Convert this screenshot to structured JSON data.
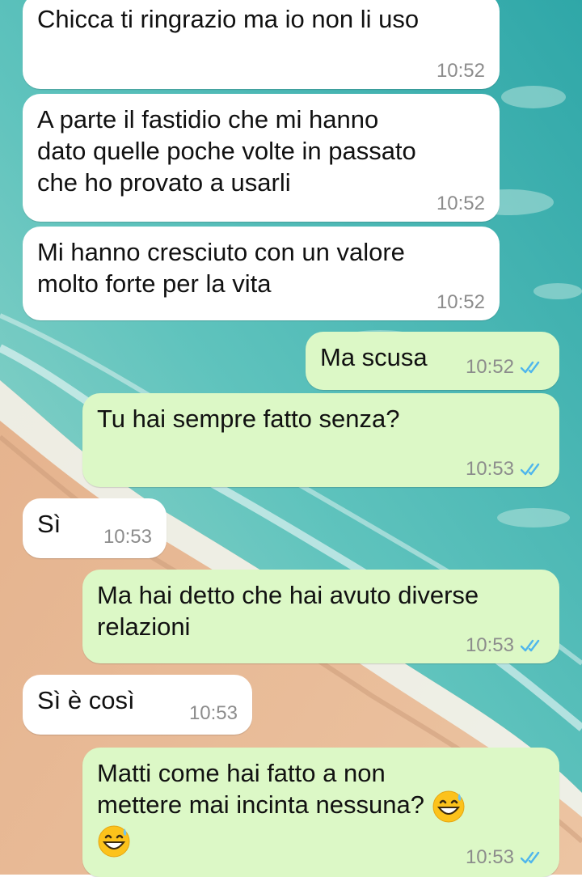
{
  "messages": [
    {
      "direction": "in",
      "text": "Chicca ti ringrazio ma io non li uso",
      "time": "10:52"
    },
    {
      "direction": "in",
      "text": "A parte il fastidio che mi hanno\ndato quelle poche volte in passato\nche ho provato a usarli",
      "time": "10:52"
    },
    {
      "direction": "in",
      "text": "Mi hanno cresciuto con un valore\nmolto forte per la vita",
      "time": "10:52"
    },
    {
      "direction": "out",
      "text": "Ma scusa",
      "time": "10:52",
      "status": "read"
    },
    {
      "direction": "out",
      "text": "Tu hai sempre fatto senza?",
      "time": "10:53",
      "status": "read"
    },
    {
      "direction": "in",
      "text": "Sì",
      "time": "10:53"
    },
    {
      "direction": "out",
      "text": "Ma hai detto che hai avuto diverse\nrelazioni",
      "time": "10:53",
      "status": "read"
    },
    {
      "direction": "in",
      "text": "Sì è così",
      "time": "10:53"
    },
    {
      "direction": "out",
      "text": "Matti come hai fatto a non\nmettere mai incinta nessuna?",
      "time": "10:53",
      "status": "read",
      "emoji": [
        "grinning-sweat-emoji",
        "grinning-sweat-emoji"
      ]
    }
  ],
  "colors": {
    "incoming_bubble": "#ffffff",
    "outgoing_bubble": "#dcf8c6",
    "read_ticks": "#4fb6ec",
    "timestamp": "#8c8c8c"
  }
}
